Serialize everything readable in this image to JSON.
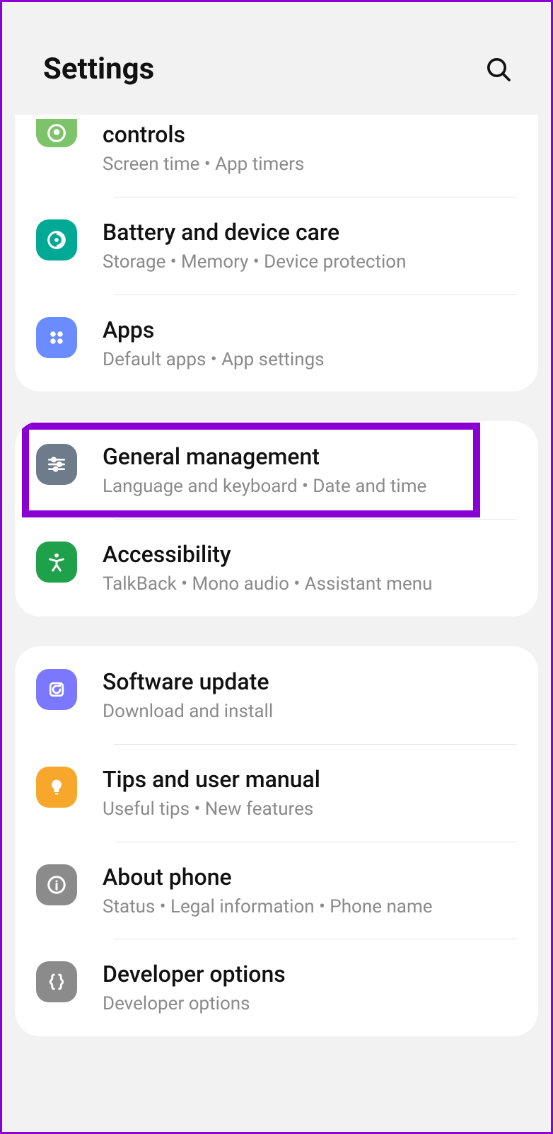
{
  "header": {
    "title": "Settings"
  },
  "sections": [
    {
      "items": [
        {
          "title": "controls",
          "sub": "Screen time  •  App timers"
        },
        {
          "title": "Battery and device care",
          "sub": "Storage  •  Memory  •  Device protection"
        },
        {
          "title": "Apps",
          "sub": "Default apps  •  App settings"
        }
      ]
    },
    {
      "items": [
        {
          "title": "General management",
          "sub": "Language and keyboard  •  Date and time"
        },
        {
          "title": "Accessibility",
          "sub": "TalkBack  •  Mono audio  •  Assistant menu"
        }
      ]
    },
    {
      "items": [
        {
          "title": "Software update",
          "sub": "Download and install"
        },
        {
          "title": "Tips and user manual",
          "sub": "Useful tips  •  New features"
        },
        {
          "title": "About phone",
          "sub": "Status  •  Legal information  •  Phone name"
        },
        {
          "title": "Developer options",
          "sub": "Developer options"
        }
      ]
    }
  ]
}
